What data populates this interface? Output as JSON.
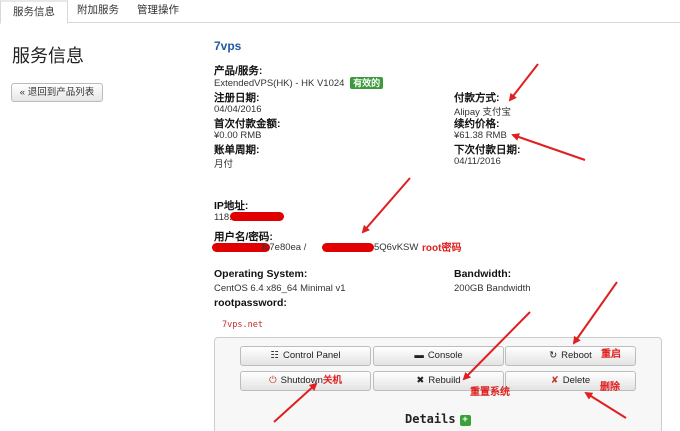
{
  "tabs": [
    {
      "label": "服务信息"
    },
    {
      "label": "附加服务"
    },
    {
      "label": "管理操作"
    }
  ],
  "page_title": "服务信息",
  "back_label": "« 退回到产品列表",
  "product_name": "7vps",
  "fields": {
    "product": {
      "label": "产品/服务:",
      "value": "ExtendedVPS(HK) - HK V1024",
      "badge": "有效的"
    },
    "reg_date": {
      "label": "注册日期:",
      "value": "04/04/2016"
    },
    "first_amount": {
      "label": "首次付款金额:",
      "value": "¥0.00 RMB"
    },
    "billing_cycle": {
      "label": "账单周期:",
      "value": "月付"
    },
    "payment_method": {
      "label": "付款方式:",
      "value": "Alipay 支付宝"
    },
    "renew_price": {
      "label": "续约价格:",
      "value": "¥61.38 RMB"
    },
    "next_due": {
      "label": "下次付款日期:",
      "value": "04/11/2016"
    },
    "ip": {
      "label": "IP地址:",
      "value_prefix": "118."
    },
    "credentials": {
      "label": "用户名/密码:",
      "value_mid": "fc7e80ea /",
      "value_end": "5Q6vKSW"
    },
    "os": {
      "label": "Operating System:",
      "value": "CentOS 6.4 x86_64 Minimal v1"
    },
    "bandwidth": {
      "label": "Bandwidth:",
      "value": "200GB Bandwidth"
    },
    "rootpassword": {
      "label": "rootpassword:"
    }
  },
  "watermark": "7vps.net",
  "annotations": {
    "root_pw": "root密码",
    "reboot": "重启",
    "delete": "删除",
    "rebuild": "重置系统",
    "shutdown": "关机"
  },
  "buttons": {
    "control_panel": "Control Panel",
    "console": "Console",
    "reboot": "Reboot",
    "shutdown": "Shutdown",
    "rebuild": "Rebuild",
    "delete": "Delete"
  },
  "details_label": "Details",
  "colors": {
    "accent_link": "#1d5aa6",
    "badge_green": "#3c9a3c",
    "annotation_red": "#e02020"
  }
}
